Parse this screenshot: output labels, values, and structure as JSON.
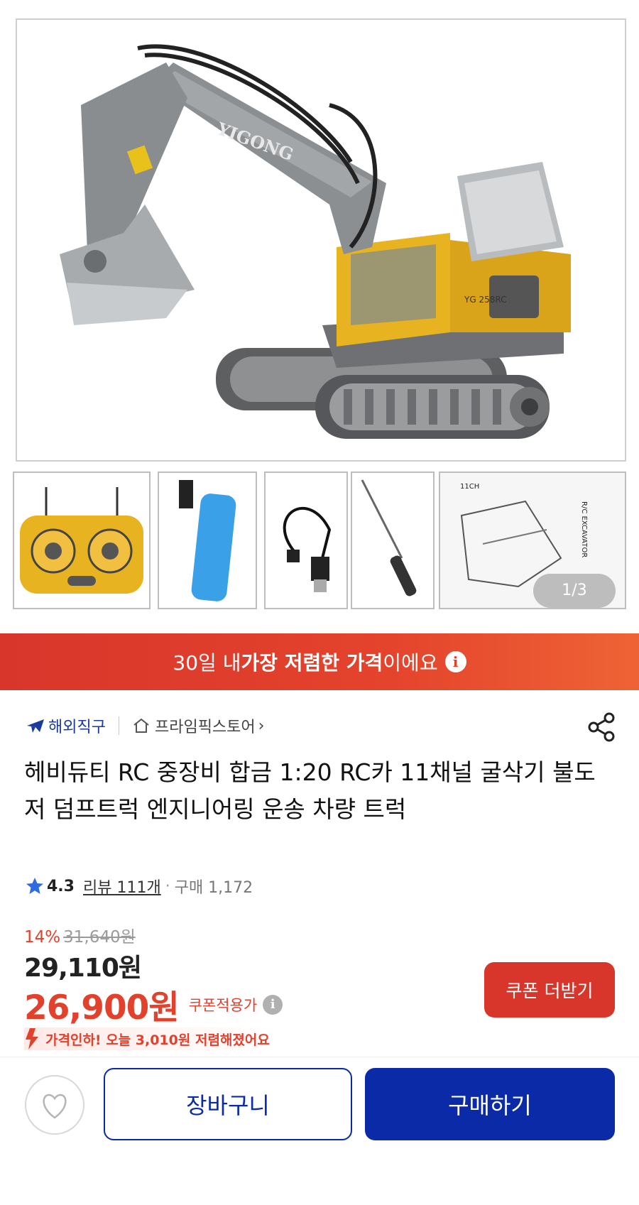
{
  "gallery": {
    "brand_print": "YIGONG",
    "model_print": "YG 258RC",
    "manual_print": "R/C EXCAVATOR",
    "manual_channels": "11CH",
    "counter": "1/3"
  },
  "banner": {
    "prefix": "30일 내 ",
    "highlight": "가장 저렴한 가격",
    "suffix": "이에요",
    "info_icon": "i"
  },
  "meta": {
    "overseas_label": "해외직구",
    "store_label": "프라임픽스토어",
    "store_chevron": "›"
  },
  "product": {
    "title": "헤비듀티 RC 중장비 합금 1:20 RC카 11채널 굴삭기 불도저 덤프트럭 엔지니어링 운송 차량 트럭"
  },
  "rating": {
    "score": "4.3",
    "reviews": "리뷰 111개",
    "separator": "·",
    "purchases": "구매 1,172"
  },
  "price": {
    "discount_pct": "14%",
    "original": "31,640원",
    "sale": "29,110원",
    "coupon_price": "26,900원",
    "coupon_label": "쿠폰적용가",
    "info_icon": "i",
    "drop_text": "가격인하! 오늘 3,010원 저렴해졌어요"
  },
  "buttons": {
    "coupon": "쿠폰 더받기",
    "cart": "장바구니",
    "buy": "구매하기"
  },
  "colors": {
    "accent_red": "#e2412c",
    "primary_blue": "#0a2aa8",
    "excavator_yellow": "#e8b320"
  }
}
